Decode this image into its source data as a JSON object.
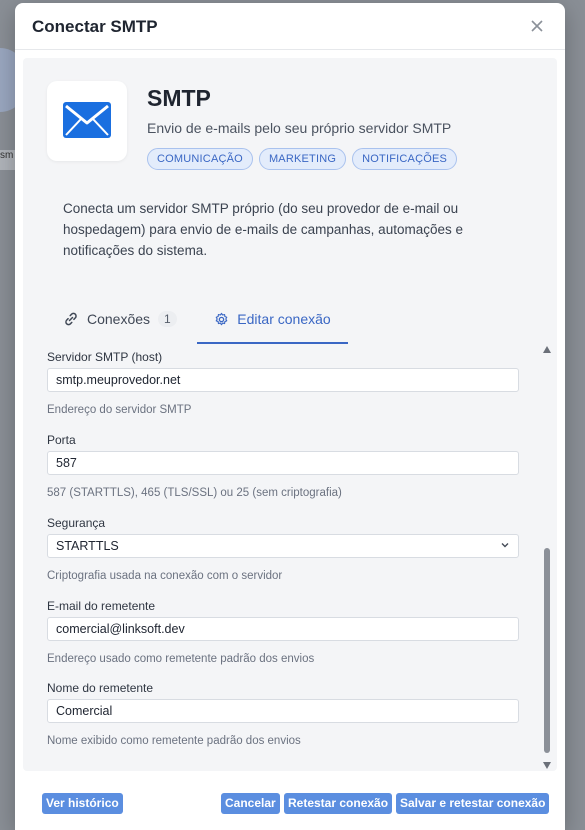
{
  "modal": {
    "title": "Conectar SMTP"
  },
  "app": {
    "icon": "envelope-icon",
    "name": "SMTP",
    "description": "Envio de e-mails pelo seu próprio servidor SMTP",
    "tags": [
      "COMUNICAÇÃO",
      "MARKETING",
      "NOTIFICAÇÕES"
    ],
    "intro": "Conecta um servidor SMTP próprio (do seu provedor de e-mail ou hospedagem) para envio de e-mails de campanhas, automações e notificações do sistema."
  },
  "tabs": {
    "connections_label": "Conexões",
    "connections_count": "1",
    "edit_label": "Editar conexão"
  },
  "form": {
    "host": {
      "label": "Servidor SMTP (host)",
      "value": "smtp.meuprovedor.net",
      "help": "Endereço do servidor SMTP"
    },
    "port": {
      "label": "Porta",
      "value": "587",
      "help": "587 (STARTTLS), 465 (TLS/SSL) ou 25 (sem criptografia)"
    },
    "security": {
      "label": "Segurança",
      "value": "STARTTLS",
      "help": "Criptografia usada na conexão com o servidor"
    },
    "sender_email": {
      "label": "E-mail do remetente",
      "value": "comercial@linksoft.dev",
      "help": "Endereço usado como remetente padrão dos envios"
    },
    "sender_name": {
      "label": "Nome do remetente",
      "value": "Comercial",
      "help": "Nome exibido como remetente padrão dos envios"
    }
  },
  "footer": {
    "history": "Ver histórico",
    "cancel": "Cancelar",
    "retest": "Retestar conexão",
    "save_retest": "Salvar e retestar conexão"
  },
  "colors": {
    "accent": "#3a67c4",
    "button": "#5b8ee0",
    "tag_bg": "#e3ecfb"
  },
  "background": {
    "partial_text": "sm"
  }
}
